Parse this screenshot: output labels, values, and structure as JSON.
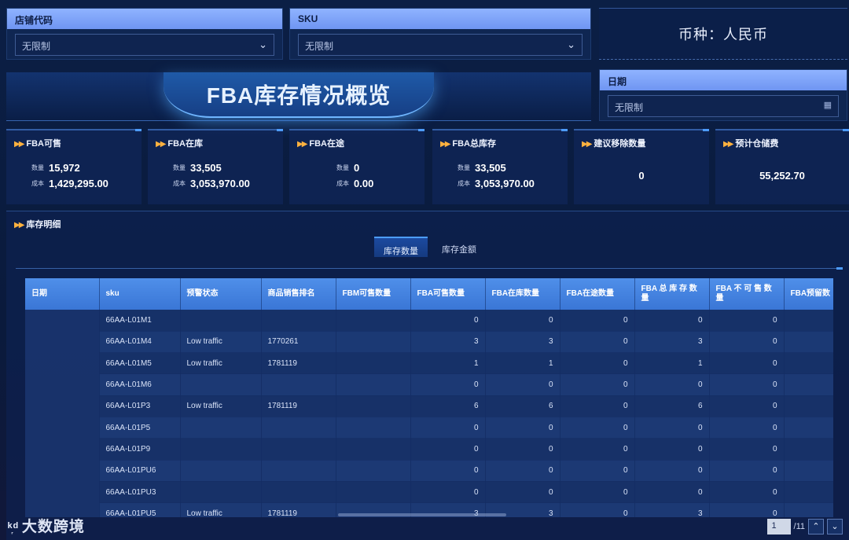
{
  "filters": {
    "store": {
      "label": "店铺代码",
      "value": "无限制"
    },
    "sku": {
      "label": "SKU",
      "value": "无限制"
    },
    "date": {
      "label": "日期",
      "value": "无限制"
    }
  },
  "currency": "币种：人民币",
  "banner_title": "FBA库存情况概览",
  "kpis": [
    {
      "title": "FBA可售",
      "qty_label": "数量",
      "qty": "15,972",
      "cost_label": "成本",
      "cost": "1,429,295.00"
    },
    {
      "title": "FBA在库",
      "qty_label": "数量",
      "qty": "33,505",
      "cost_label": "成本",
      "cost": "3,053,970.00"
    },
    {
      "title": "FBA在途",
      "qty_label": "数量",
      "qty": "0",
      "cost_label": "成本",
      "cost": "0.00"
    },
    {
      "title": "FBA总库存",
      "qty_label": "数量",
      "qty": "33,505",
      "cost_label": "成本",
      "cost": "3,053,970.00"
    },
    {
      "title": "建议移除数量",
      "value": "0"
    },
    {
      "title": "预计仓储费",
      "value": "55,252.70"
    }
  ],
  "detail": {
    "title": "库存明细",
    "tabs": [
      "库存数量",
      "库存金额"
    ],
    "columns": [
      "日期",
      "sku",
      "预警状态",
      "商品销售排名",
      "FBM可售数量",
      "FBA可售数量",
      "FBA在库数量",
      "FBA在途数量",
      "FBA 总 库 存 数 量",
      "FBA 不 可 售 数 量",
      "FBA预留数"
    ],
    "rows": [
      [
        "66AA-L01M1",
        "",
        "",
        "",
        "0",
        "0",
        "0",
        "0",
        "0"
      ],
      [
        "66AA-L01M4",
        "Low traffic",
        "1770261",
        "",
        "3",
        "3",
        "0",
        "3",
        "0"
      ],
      [
        "66AA-L01M5",
        "Low traffic",
        "1781119",
        "",
        "1",
        "1",
        "0",
        "1",
        "0"
      ],
      [
        "66AA-L01M6",
        "",
        "",
        "",
        "0",
        "0",
        "0",
        "0",
        "0"
      ],
      [
        "66AA-L01P3",
        "Low traffic",
        "1781119",
        "",
        "6",
        "6",
        "0",
        "6",
        "0"
      ],
      [
        "66AA-L01P5",
        "",
        "",
        "",
        "0",
        "0",
        "0",
        "0",
        "0"
      ],
      [
        "66AA-L01P9",
        "",
        "",
        "",
        "0",
        "0",
        "0",
        "0",
        "0"
      ],
      [
        "66AA-L01PU6",
        "",
        "",
        "",
        "0",
        "0",
        "0",
        "0",
        "0"
      ],
      [
        "66AA-L01PU3",
        "",
        "",
        "",
        "0",
        "0",
        "0",
        "0",
        "0"
      ],
      [
        "66AA-L01PU5",
        "Low traffic",
        "1781119",
        "",
        "3",
        "3",
        "0",
        "3",
        "0"
      ]
    ]
  },
  "pager": {
    "current": "1",
    "total": "/11"
  },
  "logo": {
    "mark": "ᵏ᷊ᵈ",
    "text": "大数跨境"
  }
}
